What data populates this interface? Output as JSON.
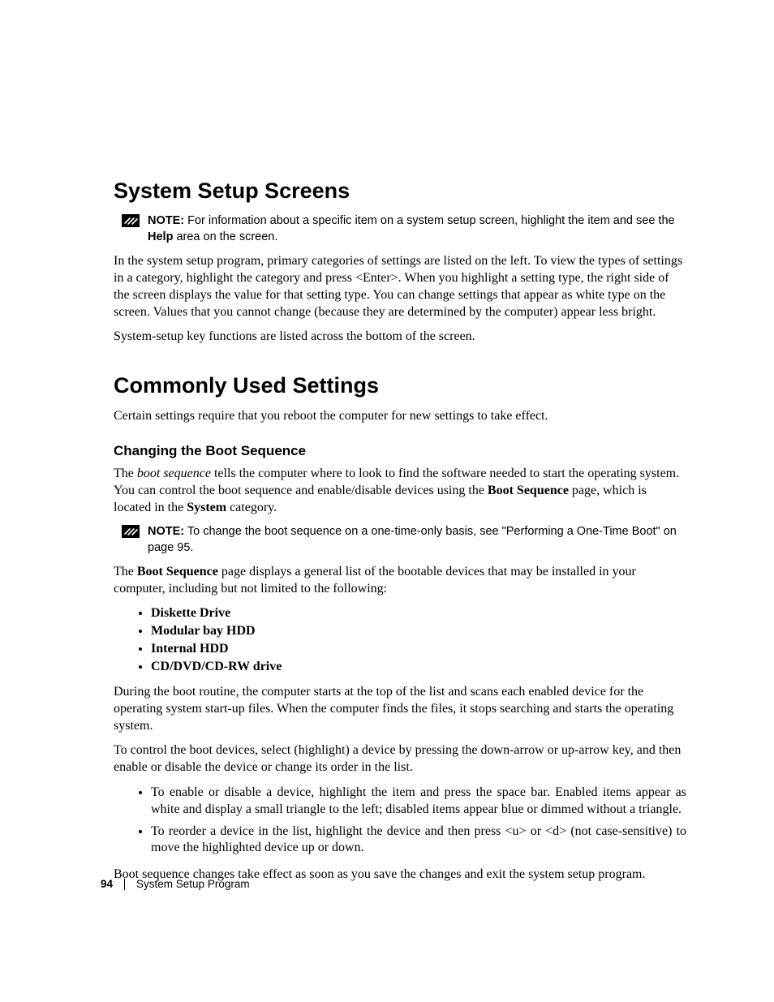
{
  "section1": {
    "title": "System Setup Screens",
    "note_lead": "NOTE:",
    "note_body_a": " For information about a specific item on a system setup screen, highlight the item and see the ",
    "note_bold": "Help",
    "note_body_b": " area on the screen.",
    "para1": "In the system setup program, primary categories of settings are listed on the left. To view the types of settings in a category, highlight the category and press <Enter>. When you highlight a setting type, the right side of the screen displays the value for that setting type. You can change settings that appear as white type on the screen. Values that you cannot change (because they are determined by the computer) appear less bright.",
    "para2": "System-setup key functions are listed across the bottom of the screen."
  },
  "section2": {
    "title": "Commonly Used Settings",
    "para1": "Certain settings require that you reboot the computer for new settings to take effect.",
    "subhead": "Changing the Boot Sequence",
    "bs_a": "The ",
    "bs_ital": "boot sequence",
    "bs_b": " tells the computer where to look to find the software needed to start the operating system. You can control the boot sequence and enable/disable devices using the ",
    "bs_bold1": "Boot Sequence",
    "bs_c": " page, which is located in the ",
    "bs_bold2": "System",
    "bs_d": " category.",
    "note_lead": "NOTE:",
    "note_body": " To change the boot sequence on a one-time-only basis, see \"Performing a One-Time Boot\" on page 95.",
    "after_note_a": "The ",
    "after_note_bold": "Boot Sequence",
    "after_note_b": " page displays a general list of the bootable devices that may be installed in your computer, including but not limited to the following:",
    "devices": [
      "Diskette Drive",
      "Modular bay HDD",
      "Internal HDD",
      "CD/DVD/CD-RW drive"
    ],
    "para_after_list1": "During the boot routine, the computer starts at the top of the list and scans each enabled device for the operating system start-up files. When the computer finds the files, it stops searching and starts the operating system.",
    "para_after_list2": "To control the boot devices, select (highlight) a device by pressing the down-arrow or up-arrow key, and then enable or disable the device or change its order in the list.",
    "bullets": [
      "To enable or disable a device, highlight the item and press the space bar. Enabled items appear as white and display a small triangle to the left; disabled items appear blue or dimmed without a triangle.",
      "To reorder a device in the list, highlight the device and then press <u> or <d> (not case-sensitive) to move the highlighted device up or down."
    ],
    "para_final": "Boot sequence changes take effect as soon as you save the changes and exit the system setup program."
  },
  "footer": {
    "page_number": "94",
    "title": "System Setup Program"
  }
}
